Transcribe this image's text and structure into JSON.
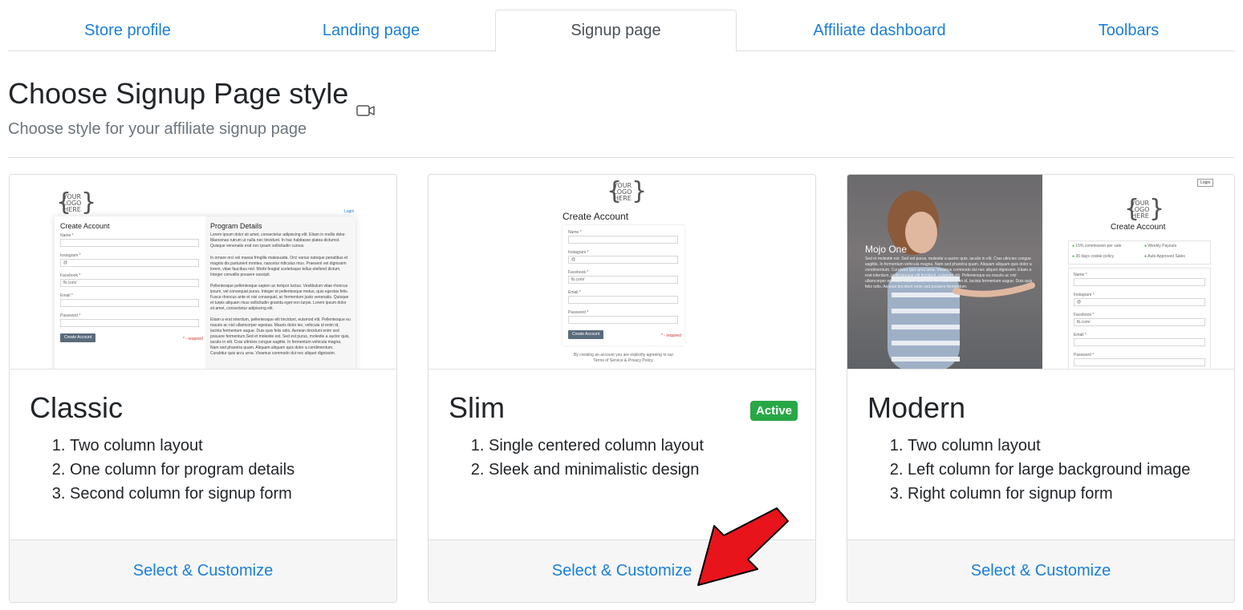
{
  "tabs": [
    {
      "label": "Store profile"
    },
    {
      "label": "Landing page"
    },
    {
      "label": "Signup page"
    },
    {
      "label": "Affiliate dashboard"
    },
    {
      "label": "Toolbars"
    }
  ],
  "active_tab": "Signup page",
  "header": {
    "title": "Choose Signup Page style",
    "subtitle": "Choose style for your affiliate signup page",
    "icon": "video-camera-icon"
  },
  "cards": [
    {
      "title": "Classic",
      "features": [
        "Two column layout",
        "One column for program details",
        "Second column for signup form"
      ],
      "action": "Select & Customize",
      "preview": {
        "logo": [
          "YOUR",
          "LOGO",
          "HERE"
        ],
        "login": "Login",
        "form_title": "Create Account",
        "details_title": "Program Details",
        "fields": [
          "Name *",
          "Instagram *",
          "Facebook *",
          "Email *",
          "Password *"
        ],
        "instagram_prefix": "@",
        "facebook_prefix": "fb.com/",
        "button": "Create Account",
        "required": "* - required",
        "para1": "Lorem ipsum dolor sit amet, consectetur adipiscing elit. Etiam in mollis dolor. Maecenas rutrum ut nulla nec tincidunt. In hac habitasse platea dictumst. Quisque venenatis erat nec ipsum sollicitudin cursus.",
        "para2": "In ornare orci vel massa fringilla malesuada. Orci varius natoque penatibus et magnis dis parturient montes, nascetur ridiculus mus. Praesent vel dignissim lorem, vitae faucibus nisl. Morbi feugiat scelerisque tellus eleifend dictum. Integer convallis posuere suscipit.",
        "para3": "Pellentesque pellentesque sapien ac tempor luctus. Vestibulum vitae rhoncus ipsum, vel consequat purus. Integer et pellentesque metus, quis egestas felis. Fusce rhoncus ante et nisi consequat, ac fermentum justo venenatis. Quisque et turpis aliquam risus sollicitudin gravida eget non turpis. Lorem ipsum dolor sit amet, consectetur adipiscing elit.",
        "para4": "Etiam a erat interdum, pellentesque elit tincidunt, euismod elit. Pellentesque eu mauris ac nisl ullamcorper egestas. Mauris dolor leo, vehicula id enim id, lacinia fermentum augue. Duis quis felis odio. Aenean tincidunt enim sed posuere fermentum.Sed et molestie est. Sed est purus, molestie a auctor quis, iaculis in elit. Cras ultricies congue sagittis. In fermentum vehicula magna. Nam sed pharetra quam. Aliquam aliquam quis dolor a condimentum. Curabitur quis arcu urna. Vivamus commodo dui nec aliquet dignissim."
      }
    },
    {
      "title": "Slim",
      "badge": "Active",
      "features": [
        "Single centered column layout",
        "Sleek and minimalistic design"
      ],
      "action": "Select & Customize",
      "preview": {
        "logo": [
          "YOUR",
          "LOGO",
          "HERE"
        ],
        "form_title": "Create Account",
        "fields": [
          "Name *",
          "Instagram *",
          "Facebook *",
          "Email *",
          "Password *"
        ],
        "instagram_prefix": "@",
        "facebook_prefix": "fb.com/",
        "button": "Create Account",
        "required": "* - required",
        "terms": "By creating an account you are explicitly agreeing to our Terms of Service & Privacy Policy."
      }
    },
    {
      "title": "Modern",
      "features": [
        "Two column layout",
        "Left column for large background image",
        "Right column for signup form"
      ],
      "action": "Select & Customize",
      "preview": {
        "login": "Login",
        "logo": [
          "YOUR",
          "LOGO",
          "HERE"
        ],
        "form_title": "Create Account",
        "brand": "Mojo One",
        "hero_text": "Sed et molestie est. Sed est purus, molestie a auctor quis, iaculis in elit. Cras ultricies congue sagittis. In fermentum vehicula magna. Nam sed pharetra quam. Aliquam aliquam quis dolor a condimentum. Curabitur quis arcu urna. Vivamus commodo dui nec aliquet dignissim. Etiam a erat interdum, pellentesque elit tincidunt, euismod elit. Pellentesque eu mauris ac nisl ullamcorper egestas. Mauris dolor leo, vehicula id enim id, lacinia fermentum augue. Duis quis felis odio. Aenean tincidunt enim sed posuere fermentum.",
        "perks": [
          "15% commission per sale",
          "Weekly Payouts",
          "30 days cookie policy",
          "Auto Approved Sales"
        ],
        "fields": [
          "Name *",
          "Instagram *",
          "Facebook *",
          "Email *",
          "Password *"
        ],
        "instagram_prefix": "@",
        "facebook_prefix": "fb.com/"
      }
    }
  ],
  "colors": {
    "link": "#1a7fd8",
    "active_badge": "#28a745",
    "footer_bg": "#f6f6f6",
    "annotation_arrow": "#e8141b"
  }
}
